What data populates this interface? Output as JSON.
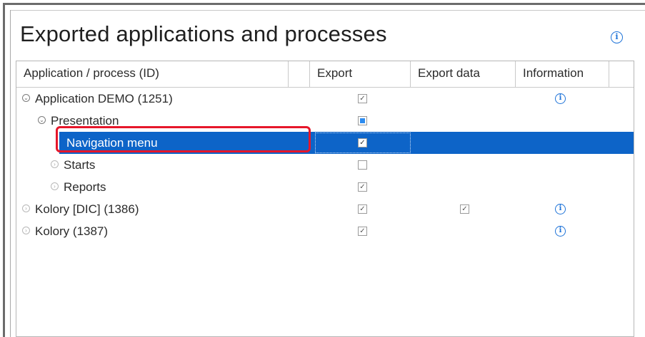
{
  "window": {
    "title": "Exported applications and processes",
    "info_icon": "info-icon"
  },
  "columns": [
    {
      "label": "Application / process (ID)"
    },
    {
      "label": "Export"
    },
    {
      "label": "Export data"
    },
    {
      "label": "Information"
    }
  ],
  "rows": [
    {
      "name": "Application DEMO (1251)",
      "level": 0,
      "expander": "expanded",
      "export": "checked",
      "export_data": "",
      "info": true
    },
    {
      "name": "Presentation",
      "level": 1,
      "expander": "expanded",
      "export": "partial",
      "export_data": "",
      "info": false
    },
    {
      "name": "Navigation menu",
      "level": 2,
      "expander": "",
      "export": "checked",
      "export_data": "",
      "info": false,
      "selected": true
    },
    {
      "name": "Starts",
      "level": 2,
      "expander": "collapsed",
      "export": "unchecked",
      "export_data": "",
      "info": false
    },
    {
      "name": "Reports",
      "level": 2,
      "expander": "collapsed",
      "export": "checked",
      "export_data": "",
      "info": false
    },
    {
      "name": "Kolory [DIC] (1386)",
      "level": 0,
      "expander": "collapsed",
      "export": "checked",
      "export_data": "checked",
      "info": true
    },
    {
      "name": "Kolory (1387)",
      "level": 0,
      "expander": "collapsed",
      "export": "checked",
      "export_data": "",
      "info": true
    }
  ],
  "colors": {
    "selection": "#0d64c8",
    "highlight": "#e6162a",
    "info": "#1e73d8",
    "partial_check": "#2d8cf0"
  }
}
